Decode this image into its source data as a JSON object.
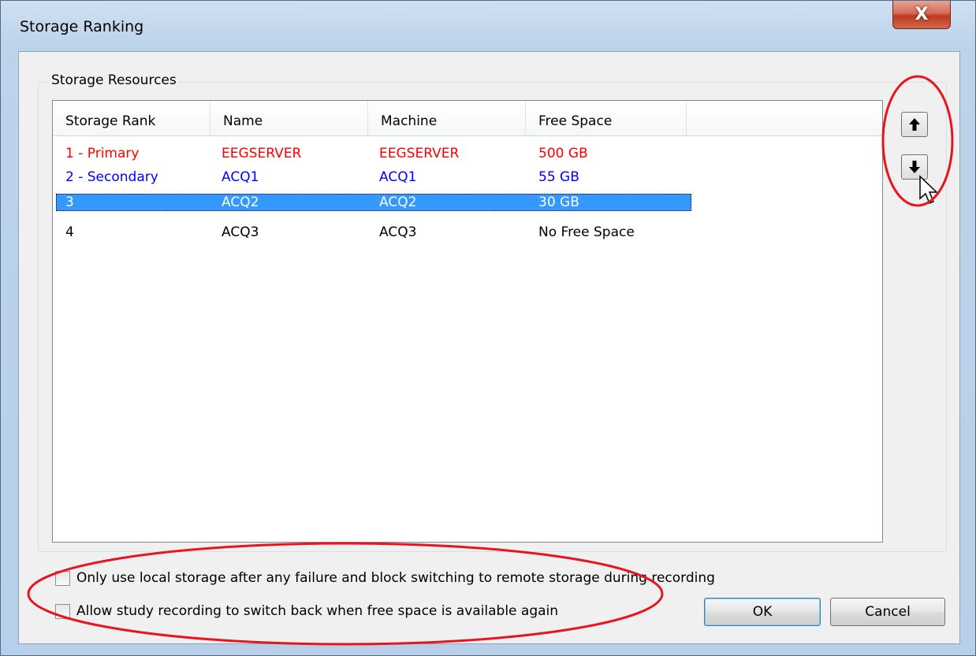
{
  "window": {
    "title": "Storage Ranking",
    "close_glyph": "X"
  },
  "group": {
    "label": "Storage Resources"
  },
  "list": {
    "columns": [
      "Storage Rank",
      "Name",
      "Machine",
      "Free Space"
    ],
    "rows": [
      {
        "rank": "1 - Primary",
        "name": "EEGSERVER",
        "machine": "EEGSERVER",
        "free": "500 GB",
        "color": "#ff0000",
        "selected": false
      },
      {
        "rank": "2 - Secondary",
        "name": "ACQ1",
        "machine": "ACQ1",
        "free": "55 GB",
        "color": "#0000ff",
        "selected": false
      },
      {
        "rank": "3",
        "name": "ACQ2",
        "machine": "ACQ2",
        "free": "30 GB",
        "color": "#ffffff",
        "selected": true
      },
      {
        "rank": "4",
        "name": "ACQ3",
        "machine": "ACQ3",
        "free": "No Free Space",
        "color": "#000000",
        "selected": false
      }
    ]
  },
  "buttons": {
    "move_up_icon": "arrow-up",
    "move_down_icon": "arrow-down",
    "ok": "OK",
    "cancel": "Cancel"
  },
  "options": {
    "local_only": "Only use local storage after any failure and block switching to remote storage during recording",
    "switch_back": "Allow study recording to switch back when free space is available again",
    "local_only_checked": false,
    "switch_back_checked": false
  },
  "colors": {
    "primary_text": "#ff0000",
    "secondary_text": "#0000ff",
    "selection": "#3399ff",
    "annotation": "#e8141e"
  }
}
